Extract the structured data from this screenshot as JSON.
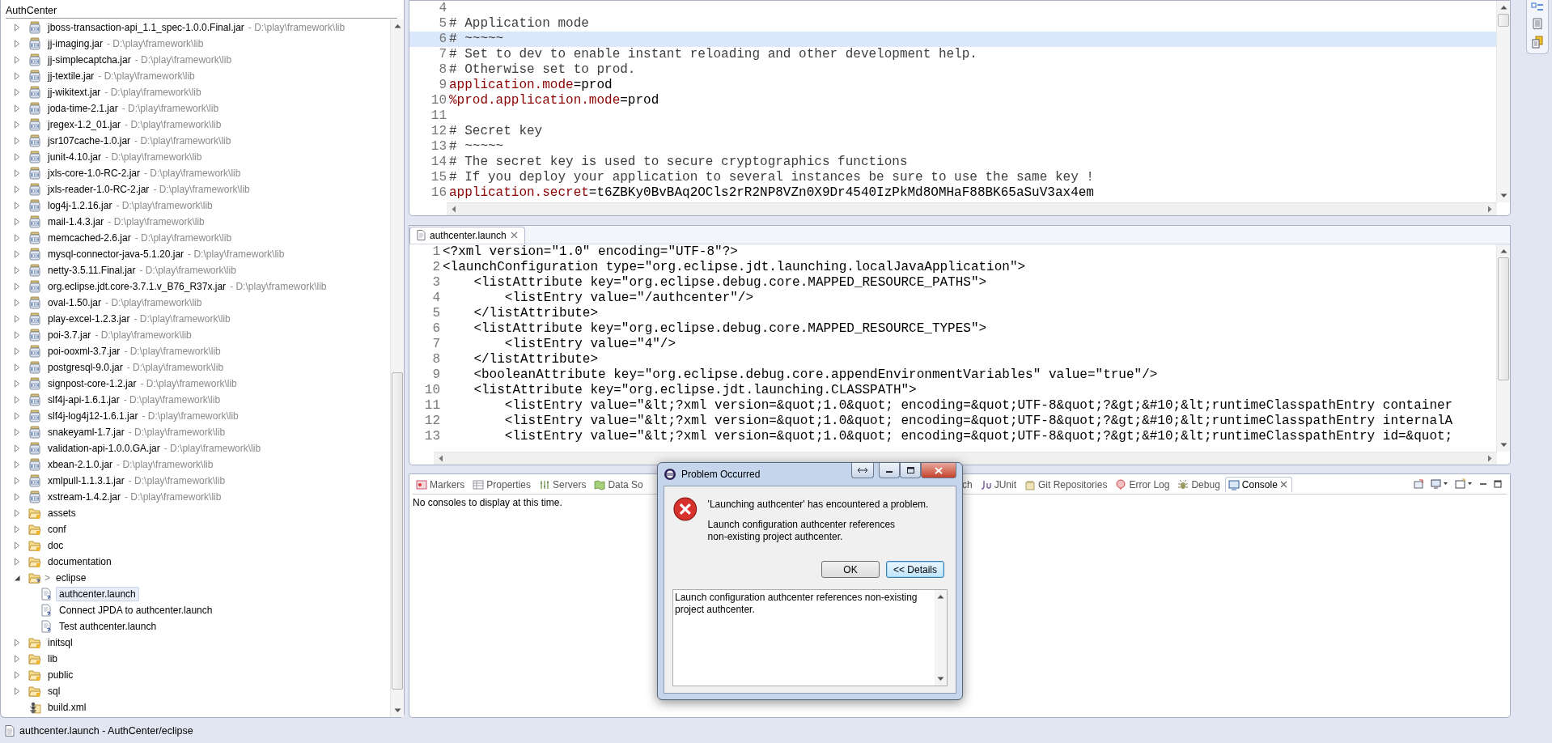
{
  "explorer": {
    "breadcrumb": "AuthCenter",
    "tree": [
      {
        "label": "jboss-transaction-api_1.1_spec-1.0.0.Final.jar",
        "suffix": "- D:\\play\\framework\\lib",
        "kind": "jar",
        "expanded": false,
        "selected": false
      },
      {
        "label": "jj-imaging.jar",
        "suffix": "- D:\\play\\framework\\lib",
        "kind": "jar",
        "expanded": false,
        "selected": false
      },
      {
        "label": "jj-simplecaptcha.jar",
        "suffix": "- D:\\play\\framework\\lib",
        "kind": "jar",
        "expanded": false,
        "selected": false
      },
      {
        "label": "jj-textile.jar",
        "suffix": "- D:\\play\\framework\\lib",
        "kind": "jar",
        "expanded": false,
        "selected": false
      },
      {
        "label": "jj-wikitext.jar",
        "suffix": "- D:\\play\\framework\\lib",
        "kind": "jar",
        "expanded": false,
        "selected": false
      },
      {
        "label": "joda-time-2.1.jar",
        "suffix": "- D:\\play\\framework\\lib",
        "kind": "jar",
        "expanded": false,
        "selected": false
      },
      {
        "label": "jregex-1.2_01.jar",
        "suffix": "- D:\\play\\framework\\lib",
        "kind": "jar",
        "expanded": false,
        "selected": false
      },
      {
        "label": "jsr107cache-1.0.jar",
        "suffix": "- D:\\play\\framework\\lib",
        "kind": "jar",
        "expanded": false,
        "selected": false
      },
      {
        "label": "junit-4.10.jar",
        "suffix": "- D:\\play\\framework\\lib",
        "kind": "jar",
        "expanded": false,
        "selected": false
      },
      {
        "label": "jxls-core-1.0-RC-2.jar",
        "suffix": "- D:\\play\\framework\\lib",
        "kind": "jar",
        "expanded": false,
        "selected": false
      },
      {
        "label": "jxls-reader-1.0-RC-2.jar",
        "suffix": "- D:\\play\\framework\\lib",
        "kind": "jar",
        "expanded": false,
        "selected": false
      },
      {
        "label": "log4j-1.2.16.jar",
        "suffix": "- D:\\play\\framework\\lib",
        "kind": "jar",
        "expanded": false,
        "selected": false
      },
      {
        "label": "mail-1.4.3.jar",
        "suffix": "- D:\\play\\framework\\lib",
        "kind": "jar",
        "expanded": false,
        "selected": false
      },
      {
        "label": "memcached-2.6.jar",
        "suffix": "- D:\\play\\framework\\lib",
        "kind": "jar",
        "expanded": false,
        "selected": false
      },
      {
        "label": "mysql-connector-java-5.1.20.jar",
        "suffix": "- D:\\play\\framework\\lib",
        "kind": "jar",
        "expanded": false,
        "selected": false
      },
      {
        "label": "netty-3.5.11.Final.jar",
        "suffix": "- D:\\play\\framework\\lib",
        "kind": "jar",
        "expanded": false,
        "selected": false
      },
      {
        "label": "org.eclipse.jdt.core-3.7.1.v_B76_R37x.jar",
        "suffix": "- D:\\play\\framework\\lib",
        "kind": "jar",
        "expanded": false,
        "selected": false
      },
      {
        "label": "oval-1.50.jar",
        "suffix": "- D:\\play\\framework\\lib",
        "kind": "jar",
        "expanded": false,
        "selected": false
      },
      {
        "label": "play-excel-1.2.3.jar",
        "suffix": "- D:\\play\\framework\\lib",
        "kind": "jar",
        "expanded": false,
        "selected": false
      },
      {
        "label": "poi-3.7.jar",
        "suffix": "- D:\\play\\framework\\lib",
        "kind": "jar",
        "expanded": false,
        "selected": false
      },
      {
        "label": "poi-ooxml-3.7.jar",
        "suffix": "- D:\\play\\framework\\lib",
        "kind": "jar",
        "expanded": false,
        "selected": false
      },
      {
        "label": "postgresql-9.0.jar",
        "suffix": "- D:\\play\\framework\\lib",
        "kind": "jar",
        "expanded": false,
        "selected": false
      },
      {
        "label": "signpost-core-1.2.jar",
        "suffix": "- D:\\play\\framework\\lib",
        "kind": "jar",
        "expanded": false,
        "selected": false
      },
      {
        "label": "slf4j-api-1.6.1.jar",
        "suffix": "- D:\\play\\framework\\lib",
        "kind": "jar",
        "expanded": false,
        "selected": false
      },
      {
        "label": "slf4j-log4j12-1.6.1.jar",
        "suffix": "- D:\\play\\framework\\lib",
        "kind": "jar",
        "expanded": false,
        "selected": false
      },
      {
        "label": "snakeyaml-1.7.jar",
        "suffix": "- D:\\play\\framework\\lib",
        "kind": "jar",
        "expanded": false,
        "selected": false
      },
      {
        "label": "validation-api-1.0.0.GA.jar",
        "suffix": "- D:\\play\\framework\\lib",
        "kind": "jar",
        "expanded": false,
        "selected": false
      },
      {
        "label": "xbean-2.1.0.jar",
        "suffix": "- D:\\play\\framework\\lib",
        "kind": "jar",
        "expanded": false,
        "selected": false
      },
      {
        "label": "xmlpull-1.1.3.1.jar",
        "suffix": "- D:\\play\\framework\\lib",
        "kind": "jar",
        "expanded": false,
        "selected": false
      },
      {
        "label": "xstream-1.4.2.jar",
        "suffix": "- D:\\play\\framework\\lib",
        "kind": "jar",
        "expanded": false,
        "selected": false
      },
      {
        "label": "assets",
        "kind": "folder",
        "expanded": false,
        "selected": false
      },
      {
        "label": "conf",
        "kind": "folder",
        "expanded": false,
        "selected": false
      },
      {
        "label": "doc",
        "kind": "folder",
        "expanded": false,
        "selected": false
      },
      {
        "label": "documentation",
        "kind": "folder",
        "expanded": false,
        "selected": false
      },
      {
        "label": "eclipse",
        "decoration": ">",
        "kind": "untracked-folder",
        "expanded": true,
        "selected": false,
        "children": [
          {
            "label": "authcenter.launch",
            "kind": "launch",
            "selected": true
          },
          {
            "label": "Connect JPDA to authcenter.launch",
            "kind": "launch",
            "selected": false
          },
          {
            "label": "Test authcenter.launch",
            "kind": "launch",
            "selected": false
          }
        ]
      },
      {
        "label": "initsql",
        "kind": "folder",
        "expanded": false,
        "selected": false
      },
      {
        "label": "lib",
        "kind": "folder",
        "expanded": false,
        "selected": false
      },
      {
        "label": "public",
        "kind": "folder",
        "expanded": false,
        "selected": false
      },
      {
        "label": "sql",
        "kind": "folder",
        "expanded": false,
        "selected": false
      },
      {
        "label": "build.xml",
        "kind": "build",
        "selected": false
      }
    ]
  },
  "editor_top": {
    "lines": [
      {
        "number": "4",
        "current": false
      },
      {
        "number": "5",
        "current": false,
        "segments": [
          {
            "text": "# Application mode",
            "kind": "comment"
          }
        ]
      },
      {
        "number": "6",
        "current": true,
        "segments": [
          {
            "text": "# ~~~~~",
            "kind": "comment"
          }
        ]
      },
      {
        "number": "7",
        "current": false,
        "segments": [
          {
            "text": "# Set to dev to enable instant reloading and other development help.",
            "kind": "comment"
          }
        ]
      },
      {
        "number": "8",
        "current": false,
        "segments": [
          {
            "text": "# Otherwise set to prod.",
            "kind": "comment"
          }
        ]
      },
      {
        "number": "9",
        "current": false,
        "segments": [
          {
            "text": "application.mode",
            "kind": "key"
          },
          {
            "text": "=prod",
            "kind": "value"
          }
        ]
      },
      {
        "number": "10",
        "current": false,
        "segments": [
          {
            "text": "%prod.application.mode",
            "kind": "key"
          },
          {
            "text": "=prod",
            "kind": "value"
          }
        ]
      },
      {
        "number": "11",
        "current": false
      },
      {
        "number": "12",
        "current": false,
        "segments": [
          {
            "text": "# Secret key",
            "kind": "comment"
          }
        ]
      },
      {
        "number": "13",
        "current": false,
        "segments": [
          {
            "text": "# ~~~~~",
            "kind": "comment"
          }
        ]
      },
      {
        "number": "14",
        "current": false,
        "segments": [
          {
            "text": "# The secret key is used to secure cryptographics functions",
            "kind": "comment"
          }
        ]
      },
      {
        "number": "15",
        "current": false,
        "segments": [
          {
            "text": "# If you deploy your application to several instances be sure to use the same key !",
            "kind": "comment"
          }
        ]
      },
      {
        "number": "16",
        "current": false,
        "segments": [
          {
            "text": "application.secret",
            "kind": "key"
          },
          {
            "text": "=t6ZBKy0BvBAq2OCls2rR2NP8VZn0X9Dr4540IzPkMd8OMHaF88BK65aSuV3ax4em",
            "kind": "value"
          }
        ]
      }
    ]
  },
  "editor_bottom": {
    "tab": {
      "label": "authcenter.launch",
      "selected": true
    },
    "lines": [
      {
        "number": "1",
        "text": "<?xml version=\"1.0\" encoding=\"UTF-8\"?>"
      },
      {
        "number": "2",
        "text": "<launchConfiguration type=\"org.eclipse.jdt.launching.localJavaApplication\">"
      },
      {
        "number": "3",
        "text": "    <listAttribute key=\"org.eclipse.debug.core.MAPPED_RESOURCE_PATHS\">"
      },
      {
        "number": "4",
        "text": "        <listEntry value=\"/authcenter\"/>"
      },
      {
        "number": "5",
        "text": "    </listAttribute>"
      },
      {
        "number": "6",
        "text": "    <listAttribute key=\"org.eclipse.debug.core.MAPPED_RESOURCE_TYPES\">"
      },
      {
        "number": "7",
        "text": "        <listEntry value=\"4\"/>"
      },
      {
        "number": "8",
        "text": "    </listAttribute>"
      },
      {
        "number": "9",
        "text": "    <booleanAttribute key=\"org.eclipse.debug.core.appendEnvironmentVariables\" value=\"true\"/>"
      },
      {
        "number": "10",
        "text": "    <listAttribute key=\"org.eclipse.jdt.launching.CLASSPATH\">"
      },
      {
        "number": "11",
        "text": "        <listEntry value=\"&lt;?xml version=&quot;1.0&quot; encoding=&quot;UTF-8&quot;?&gt;&#10;&lt;runtimeClasspathEntry container"
      },
      {
        "number": "12",
        "text": "        <listEntry value=\"&lt;?xml version=&quot;1.0&quot; encoding=&quot;UTF-8&quot;?&gt;&#10;&lt;runtimeClasspathEntry internalA"
      },
      {
        "number": "13",
        "text": "        <listEntry value=\"&lt;?xml version=&quot;1.0&quot; encoding=&quot;UTF-8&quot;?&gt;&#10;&lt;runtimeClasspathEntry id=&quot;"
      }
    ]
  },
  "console": {
    "tabs_left": [
      {
        "label": "Markers",
        "kind": "markers",
        "selected": false
      },
      {
        "label": "Properties",
        "kind": "properties",
        "selected": false
      },
      {
        "label": "Servers",
        "kind": "servers",
        "selected": false
      },
      {
        "label": "Data So",
        "kind": "data",
        "selected": false
      }
    ],
    "tabs_right": [
      {
        "label": "ch",
        "kind": "none",
        "selected": false
      },
      {
        "label": "JUnit",
        "kind": "junit",
        "selected": false
      },
      {
        "label": "Git Repositories",
        "kind": "git",
        "selected": false
      },
      {
        "label": "Error Log",
        "kind": "errorlog",
        "selected": false
      },
      {
        "label": "Debug",
        "kind": "debug",
        "selected": false
      },
      {
        "label": "Console",
        "kind": "console",
        "selected": true
      }
    ],
    "message": "No consoles to display at this time."
  },
  "dialog": {
    "title": "Problem Occurred",
    "message": "'Launching authcenter' has encountered a problem.",
    "detail": "Launch configuration authcenter references non-existing project authcenter.",
    "buttons": [
      {
        "label": "OK",
        "focused": false
      },
      {
        "label": "<< Details",
        "focused": true
      }
    ],
    "details_text": "Launch configuration authcenter references non-existing project authcenter."
  },
  "status_bar": {
    "text": "authcenter.launch - AuthCenter/eclipse"
  }
}
